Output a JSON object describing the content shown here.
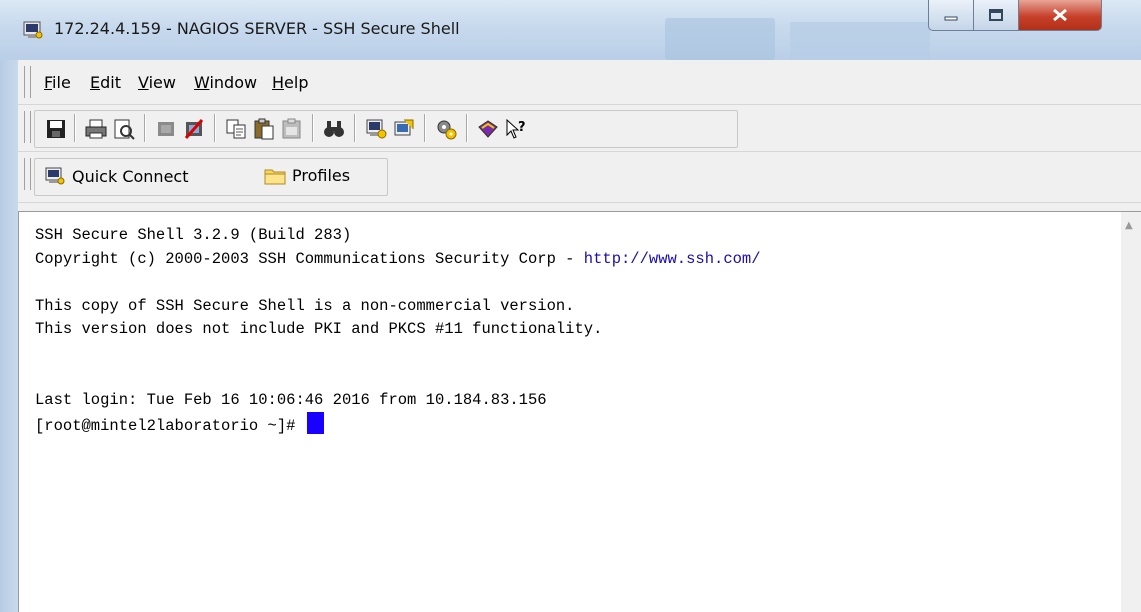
{
  "window": {
    "title": "172.24.4.159 - NAGIOS SERVER - SSH Secure Shell",
    "controls": [
      "minimize",
      "maximize",
      "close"
    ]
  },
  "menu": [
    {
      "label": "File",
      "mnemonic": "F",
      "rest": "ile"
    },
    {
      "label": "Edit",
      "mnemonic": "E",
      "rest": "dit"
    },
    {
      "label": "View",
      "mnemonic": "V",
      "rest": "iew"
    },
    {
      "label": "Window",
      "mnemonic": "W",
      "rest": "indow"
    },
    {
      "label": "Help",
      "mnemonic": "H",
      "rest": "elp"
    }
  ],
  "toolbar": {
    "icons": [
      "save-icon",
      "print-icon",
      "print-preview-icon",
      "connect-icon",
      "disconnect-icon",
      "copy-icon",
      "paste-icon",
      "paste-disabled-icon",
      "find-icon",
      "new-terminal-icon",
      "new-file-transfer-icon",
      "settings-icon",
      "help-book-icon",
      "context-help-icon"
    ]
  },
  "quickbar": {
    "quick_connect": "Quick Connect",
    "profiles": "Profiles"
  },
  "terminal": {
    "line1": "SSH Secure Shell 3.2.9 (Build 283)",
    "line2_prefix": "Copyright (c) 2000-2003 SSH Communications Security Corp - ",
    "line2_link": "http://www.ssh.com/",
    "line3": "This copy of SSH Secure Shell is a non-commercial version.",
    "line4": "This version does not include PKI and PKCS #11 functionality.",
    "line5": "Last login: Tue Feb 16 10:06:46 2016 from 10.184.83.156",
    "prompt": "[root@mintel2laboratorio ~]# "
  },
  "colors": {
    "cursor": "#1a00ff",
    "link": "#1a0db0"
  }
}
